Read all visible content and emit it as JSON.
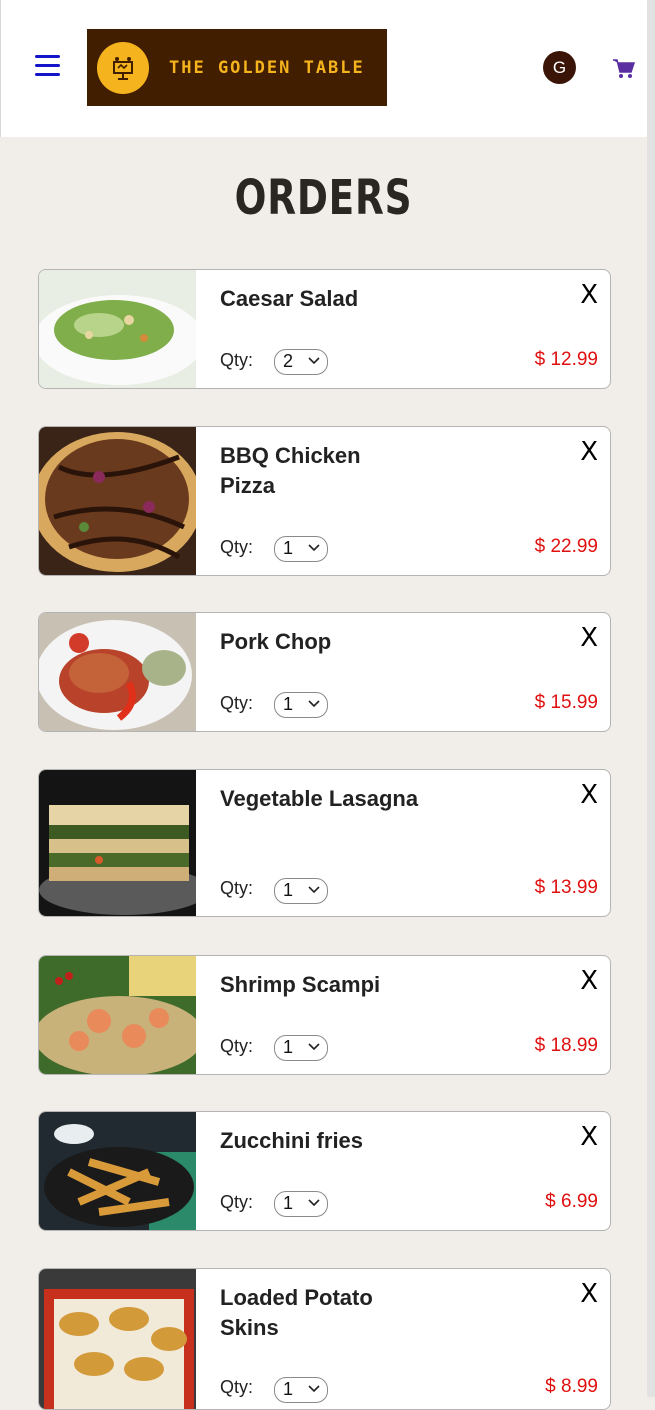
{
  "header": {
    "brand": "THE GOLDEN TABLE",
    "avatar_letter": "G"
  },
  "page": {
    "title": "ORDERS"
  },
  "orders": [
    {
      "name": "Caesar Salad",
      "qty_label": "Qty:",
      "qty": "2",
      "price": "$ 12.99",
      "close": "X",
      "image": "caesar-salad-photo"
    },
    {
      "name": "BBQ Chicken Pizza",
      "qty_label": "Qty:",
      "qty": "1",
      "price": "$ 22.99",
      "close": "X",
      "image": "bbq-pizza-photo"
    },
    {
      "name": "Pork Chop",
      "qty_label": "Qty:",
      "qty": "1",
      "price": "$ 15.99",
      "close": "X",
      "image": "pork-chop-photo"
    },
    {
      "name": "Vegetable Lasagna",
      "qty_label": "Qty:",
      "qty": "1",
      "price": "$ 13.99",
      "close": "X",
      "image": "lasagna-photo"
    },
    {
      "name": "Shrimp Scampi",
      "qty_label": "Qty:",
      "qty": "1",
      "price": "$ 18.99",
      "close": "X",
      "image": "shrimp-scampi-photo"
    },
    {
      "name": "Zucchini fries",
      "qty_label": "Qty:",
      "qty": "1",
      "price": "$ 6.99",
      "close": "X",
      "image": "zucchini-fries-photo"
    },
    {
      "name": "Loaded Potato Skins",
      "qty_label": "Qty:",
      "qty": "1",
      "price": "$ 8.99",
      "close": "X",
      "image": "potato-skins-photo"
    }
  ],
  "colors": {
    "brand_bg": "#421e00",
    "brand_gold": "#f5b41d",
    "price": "#e01010",
    "menu": "#1414c8",
    "cart": "#5a2ea0"
  }
}
